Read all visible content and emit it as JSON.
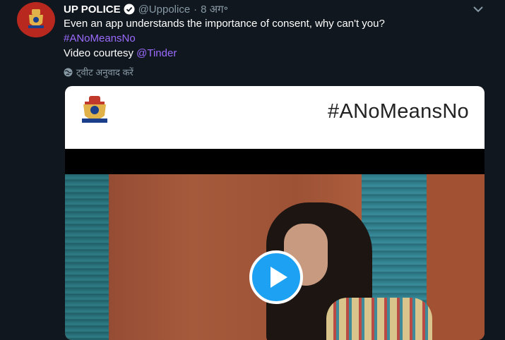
{
  "tweet": {
    "author_name": "UP POLICE",
    "handle": "@Uppolice",
    "separator": "·",
    "date": "8 अग॰",
    "text_line1": "Even an app understands the importance of consent, why can't you?",
    "hashtag": "#ANoMeansNo",
    "video_prefix": "Video courtesy",
    "mention": "@Tinder",
    "translate_label": "ट्वीट अनुवाद करें"
  },
  "media": {
    "banner_hashtag": "#ANoMeansNo"
  },
  "icons": {
    "verified": "verified-badge-icon",
    "caret": "chevron-down-icon",
    "globe": "globe-icon",
    "play": "play-icon"
  },
  "colors": {
    "background": "#10171e",
    "link": "#9b6bff",
    "muted": "#8899a6",
    "play_button": "#1da1f2"
  }
}
